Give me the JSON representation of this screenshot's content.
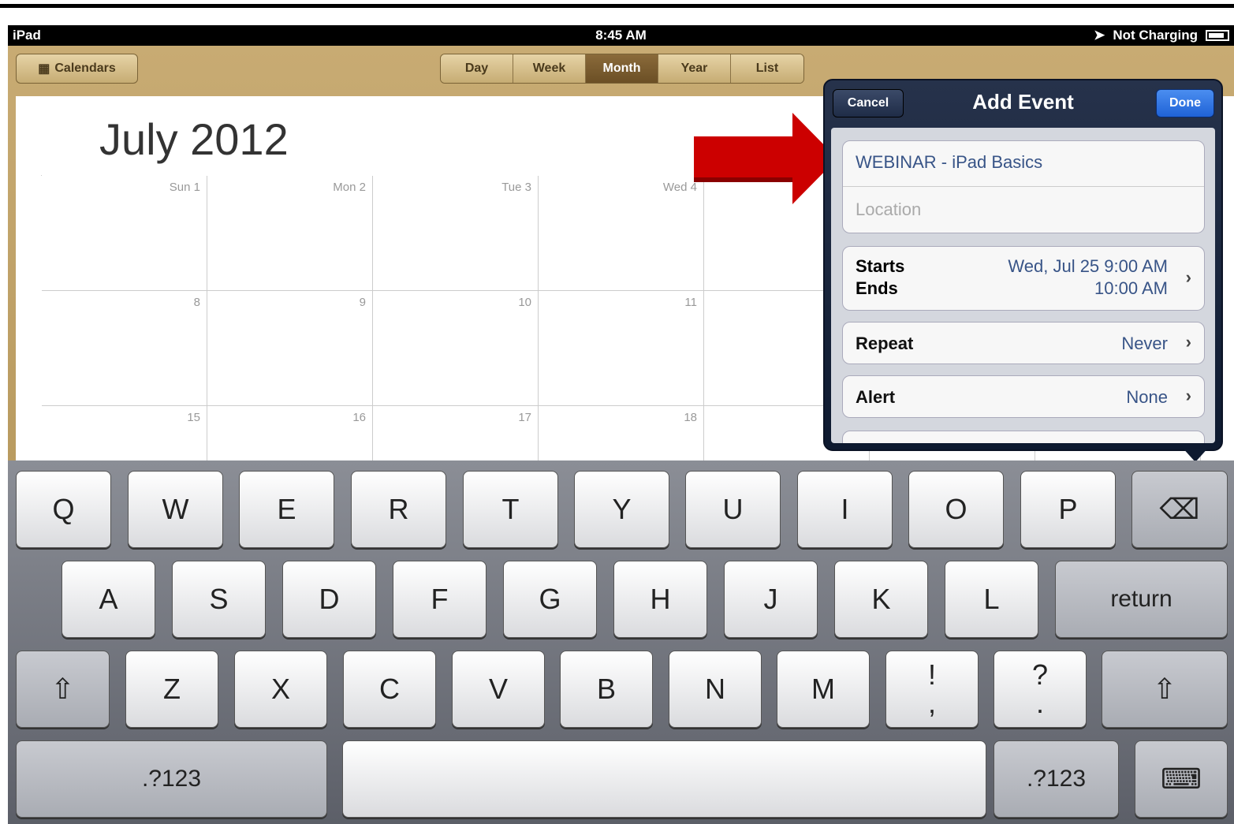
{
  "status_bar": {
    "device": "iPad",
    "time": "8:45 AM",
    "charging": "Not Charging"
  },
  "toolbar": {
    "calendars": "Calendars",
    "views": [
      {
        "label": "Day",
        "active": false
      },
      {
        "label": "Week",
        "active": false
      },
      {
        "label": "Month",
        "active": true
      },
      {
        "label": "Year",
        "active": false
      },
      {
        "label": "List",
        "active": false
      }
    ]
  },
  "calendar": {
    "title": "July 2012",
    "days": [
      "Sun 1",
      "Mon 2",
      "Tue 3",
      "Wed 4",
      "8",
      "9",
      "10",
      "11",
      "15",
      "16",
      "17",
      "18"
    ]
  },
  "add_event": {
    "title": "Add Event",
    "cancel": "Cancel",
    "done": "Done",
    "event_title": "WEBINAR - iPad Basics",
    "location_placeholder": "Location",
    "starts_label": "Starts",
    "ends_label": "Ends",
    "starts_value": "Wed, Jul 25  9:00 AM",
    "ends_value": "10:00 AM",
    "repeat_label": "Repeat",
    "repeat_value": "Never",
    "alert_label": "Alert",
    "alert_value": "None"
  },
  "keyboard": {
    "row1": [
      "Q",
      "W",
      "E",
      "R",
      "T",
      "Y",
      "U",
      "I",
      "O",
      "P"
    ],
    "row2": [
      "A",
      "S",
      "D",
      "F",
      "G",
      "H",
      "J",
      "K",
      "L"
    ],
    "row3": [
      "Z",
      "X",
      "C",
      "V",
      "B",
      "N",
      "M"
    ],
    "return": "return",
    "numbers_left": ".?123",
    "numbers_right": ".?123",
    "punct1_top": "!",
    "punct1_bottom": ",",
    "punct2_top": "?",
    "punct2_bottom": "."
  },
  "colors": {
    "accent_arrow": "#cc0000",
    "done_blue": "#1f62d6",
    "leather": "#c8ab73"
  }
}
